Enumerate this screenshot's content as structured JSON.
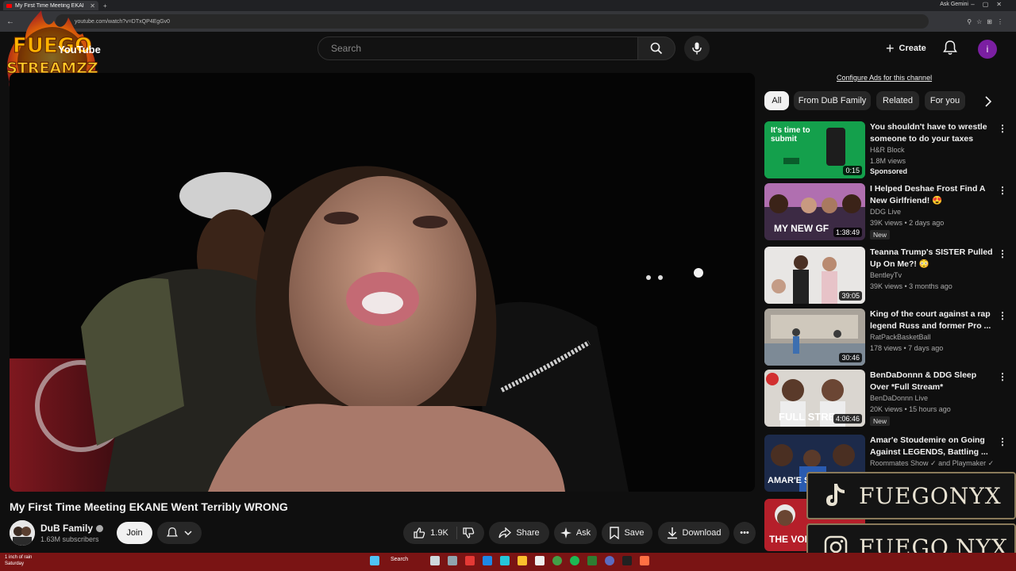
{
  "browser": {
    "tab_title": "My First Time Meeting EKAI",
    "ask_gemini": "Ask Gemini",
    "url": "youtube.com/watch?v=DTxQP4EgGv0"
  },
  "header": {
    "search_placeholder": "Search",
    "create_label": "Create",
    "avatar_letter": "i"
  },
  "logo": {
    "text_top": "FUEGO",
    "text_bottom": "STREAMZZ",
    "youtube_text": "YouTube"
  },
  "video": {
    "title": "My First Time Meeting EKANE Went Terribly WRONG"
  },
  "channel": {
    "name": "DuB Family",
    "subscribers": "1.63M subscribers",
    "join_label": "Join"
  },
  "actions": {
    "likes": "1.9K",
    "share": "Share",
    "ask": "Ask",
    "save": "Save",
    "download": "Download"
  },
  "sidebar": {
    "configure_ads": "Configure Ads for this channel",
    "chips": [
      "All",
      "From DuB Family",
      "Related",
      "For you"
    ],
    "recommendations": [
      {
        "title": "You shouldn't have to wrestle someone to do your taxes",
        "channel": "H&R Block",
        "meta": "1.8M views",
        "duration": "0:15",
        "badge": "Sponsored",
        "thumb_text": "It's time to submit"
      },
      {
        "title": "I Helped Deshae Frost Find A New Girlfriend! 😍",
        "channel": "DDG Live",
        "meta": "39K views • 2 days ago",
        "duration": "1:38:49",
        "badge": "New",
        "thumb_text": "MY NEW GF"
      },
      {
        "title": "Teanna Trump's SISTER Pulled Up On Me?! 😳",
        "channel": "BentleyTv",
        "meta": "39K views • 3 months ago",
        "duration": "39:05",
        "badge": "",
        "thumb_text": ""
      },
      {
        "title": "King of the court against a rap legend Russ and former Pro ...",
        "channel": "RatPackBasketBall",
        "meta": "178 views • 7 days ago",
        "duration": "30:46",
        "badge": "",
        "thumb_text": ""
      },
      {
        "title": "BenDaDonnn & DDG Sleep Over *Full Stream*",
        "channel": "BenDaDonnn Live",
        "meta": "20K views • 15 hours ago",
        "duration": "4:06:46",
        "badge": "New",
        "thumb_text": "FULL STRE"
      },
      {
        "title": "Amar'e Stoudemire on Going Against LEGENDS, Battling ...",
        "channel": "Roommates Show ✓ and Playmaker ✓",
        "meta": "",
        "duration": "",
        "badge": "",
        "thumb_text": "AMAR'E S"
      },
      {
        "title": "",
        "channel": "",
        "meta": "",
        "duration": "",
        "badge": "",
        "thumb_text": "THE VOIC"
      }
    ]
  },
  "overlays": {
    "tiktok": "FUEGONYX",
    "instagram": "FUEGO.NYX"
  },
  "taskbar": {
    "weather_line1": "1 inch of rain",
    "weather_line2": "Saturday",
    "search": "Search"
  },
  "colors": {
    "youtube_red": "#ff0000",
    "taskbar": "#7a1414",
    "background": "#0f0f0f"
  }
}
